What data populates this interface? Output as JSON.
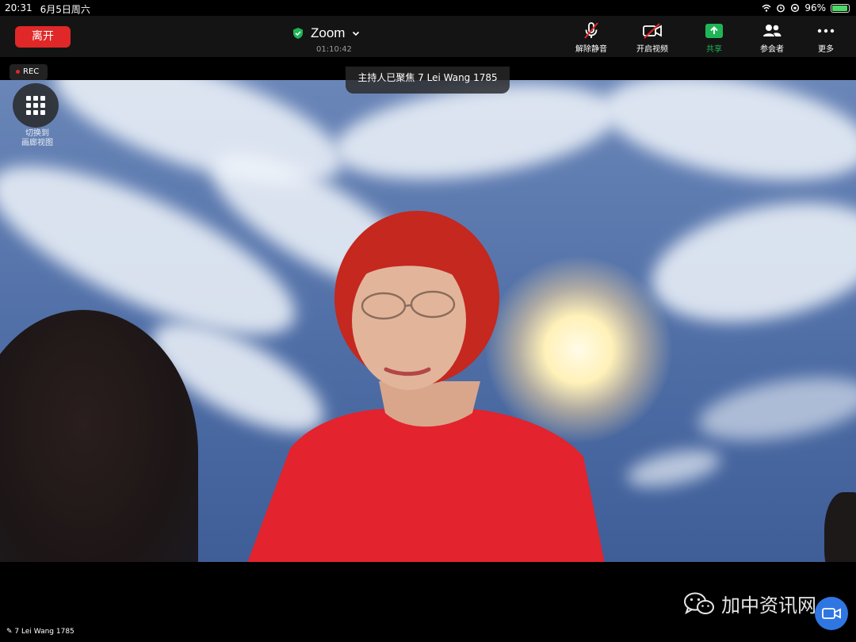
{
  "status_bar": {
    "time": "20:31",
    "date": "6月5日周六",
    "battery": "96%",
    "battery_level": 0.96
  },
  "toolbar": {
    "leave_label": "离开",
    "meeting_title": "Zoom",
    "timer": "01:10:42",
    "tools": [
      {
        "label": "解除静音",
        "icon": "mic-muted-icon"
      },
      {
        "label": "开启视频",
        "icon": "video-off-icon"
      },
      {
        "label": "共享",
        "icon": "share-icon"
      },
      {
        "label": "参会者",
        "icon": "participants-icon"
      },
      {
        "label": "更多",
        "icon": "more-icon"
      }
    ],
    "share_color": "#1fb556"
  },
  "overlay": {
    "rec_label": "REC",
    "spotlight_text": "主持人已聚焦 7 Lei Wang 1785",
    "gallery_label_line1": "切换到",
    "gallery_label_line2": "画廊视图"
  },
  "video": {
    "participant_name": "7 Lei Wang 1785"
  },
  "watermark": {
    "text": "加中资讯网"
  },
  "colors": {
    "leave": "#e02828",
    "rec_dot": "#e02828",
    "fab": "#2f76e2",
    "secure": "#1fb556"
  }
}
